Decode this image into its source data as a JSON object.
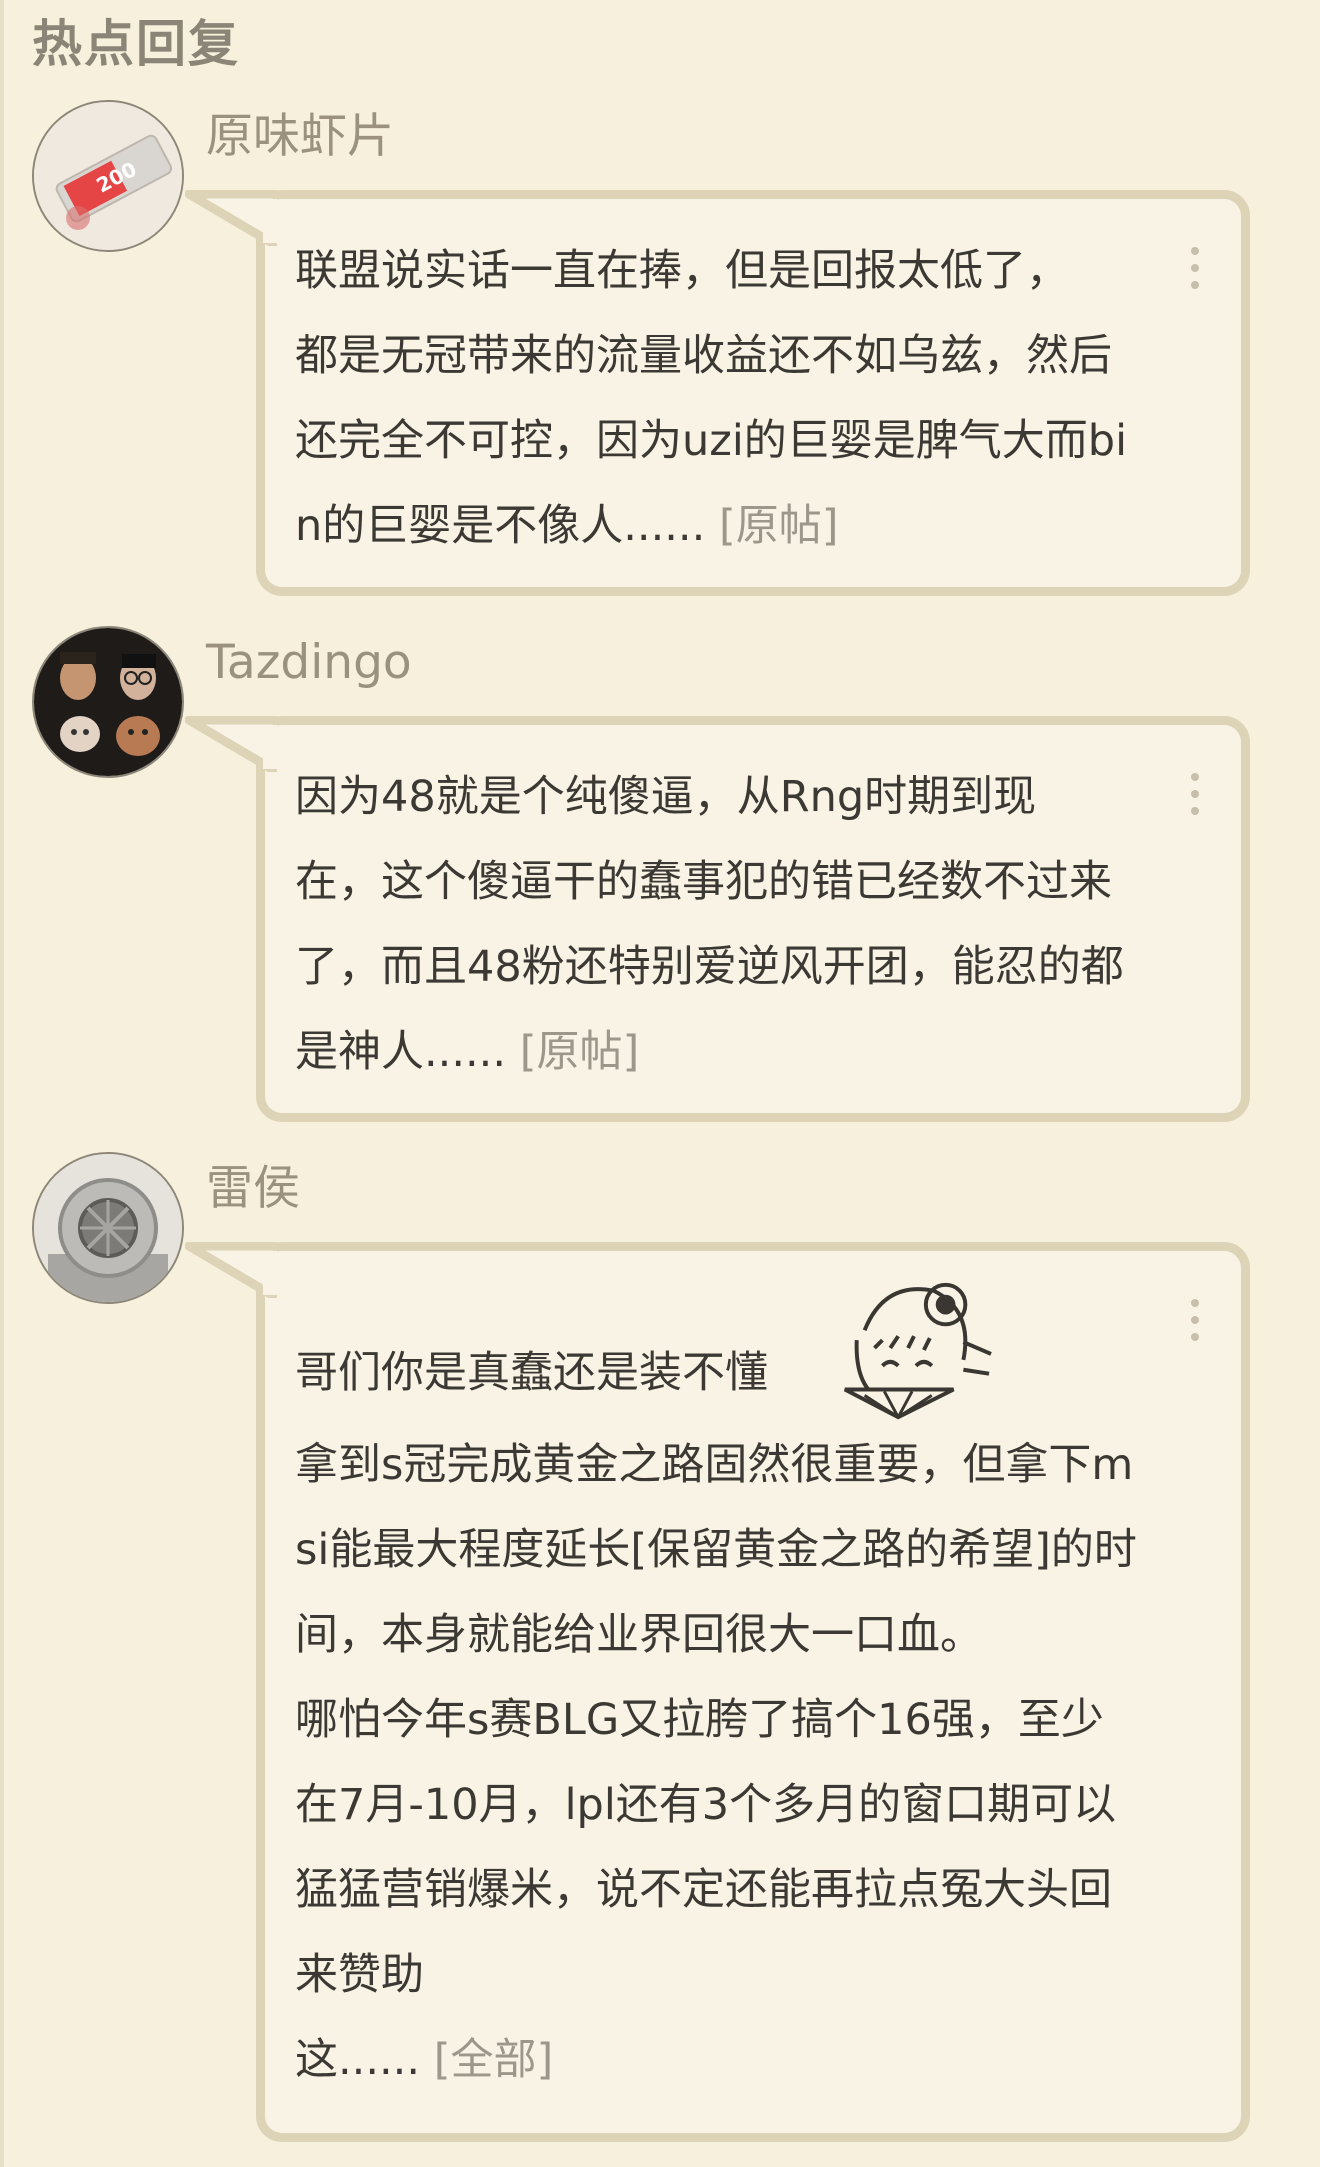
{
  "section": {
    "title": "热点回复"
  },
  "replies": [
    {
      "username": "原味虾片",
      "avatar_icon": "shrimp-chip-package-avatar",
      "lines": [
        "联盟说实话一直在捧，但是回报太低了，",
        "都是无冠带来的流量收益还不如乌兹，然后",
        "还完全不可控，因为uzi的巨婴是脾气大而bi",
        "n的巨婴是不像人......"
      ],
      "link_label": "[原帖]"
    },
    {
      "username": "Tazdingo",
      "avatar_icon": "face-collage-avatar",
      "lines": [
        "因为48就是个纯傻逼，从Rng时期到现",
        "在，这个傻逼干的蠢事犯的错已经数不过来",
        "了，而且48粉还特别爱逆风开团，能忍的都",
        "是神人......"
      ],
      "link_label": "[原帖]"
    },
    {
      "username": "雷侯",
      "avatar_icon": "diving-helmet-avatar",
      "first_line": "哥们你是真蠢还是装不懂",
      "sticker_icon": "anime-girl-fan-sticker",
      "lines": [
        "拿到s冠完成黄金之路固然很重要，但拿下m",
        "si能最大程度延长[保留黄金之路的希望]的时",
        "间，本身就能给业界回很大一口血。",
        "哪怕今年s赛BLG又拉胯了搞个16强，至少",
        "在7月-10月，lpl还有3个多月的窗口期可以",
        "猛猛营销爆米，说不定还能再拉点冤大头回",
        "来赞助",
        "这......"
      ],
      "link_label": "[全部]"
    }
  ]
}
